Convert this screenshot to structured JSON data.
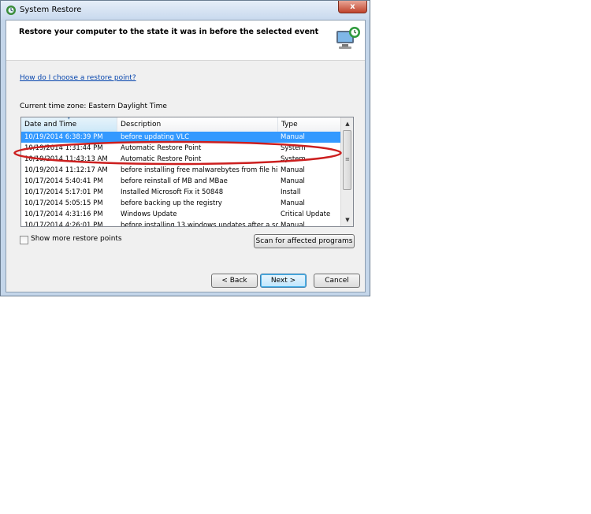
{
  "window": {
    "title": "System Restore",
    "close_label": "x"
  },
  "header": {
    "title": "Restore your computer to the state it was in before the selected event"
  },
  "help_link": "How do I choose a restore point?",
  "timezone": "Current time zone: Eastern Daylight Time",
  "list": {
    "columns": [
      "Date and Time",
      "Description",
      "Type"
    ],
    "rows": [
      {
        "date": "10/19/2014 6:38:39 PM",
        "desc": "before updating VLC",
        "type": "Manual",
        "selected": true
      },
      {
        "date": "10/19/2014 1:31:44 PM",
        "desc": "Automatic Restore Point",
        "type": "System",
        "selected": false
      },
      {
        "date": "10/19/2014 11:43:13 AM",
        "desc": "Automatic Restore Point",
        "type": "System",
        "selected": false
      },
      {
        "date": "10/19/2014 11:12:17 AM",
        "desc": "before installing free malwarebytes from file hi...",
        "type": "Manual",
        "selected": false
      },
      {
        "date": "10/17/2014 5:40:41 PM",
        "desc": "before reinstall of MB and MBae",
        "type": "Manual",
        "selected": false
      },
      {
        "date": "10/17/2014 5:17:01 PM",
        "desc": "Installed Microsoft Fix it 50848",
        "type": "Install",
        "selected": false
      },
      {
        "date": "10/17/2014 5:05:15 PM",
        "desc": "before backing up the registry",
        "type": "Manual",
        "selected": false
      },
      {
        "date": "10/17/2014 4:31:16 PM",
        "desc": "Windows Update",
        "type": "Critical Update",
        "selected": false
      },
      {
        "date": "10/17/2014 4:26:01 PM",
        "desc": "before installing 13 windows updates after a sc...",
        "type": "Manual",
        "selected": false
      }
    ]
  },
  "show_more_label": "Show more restore points",
  "show_more_checked": false,
  "buttons": {
    "scan": "Scan for affected programs",
    "back": "< Back",
    "next": "Next >",
    "cancel": "Cancel"
  },
  "colors": {
    "selection": "#3399ff",
    "annotation": "#cc1f1f",
    "link": "#0645ad"
  }
}
